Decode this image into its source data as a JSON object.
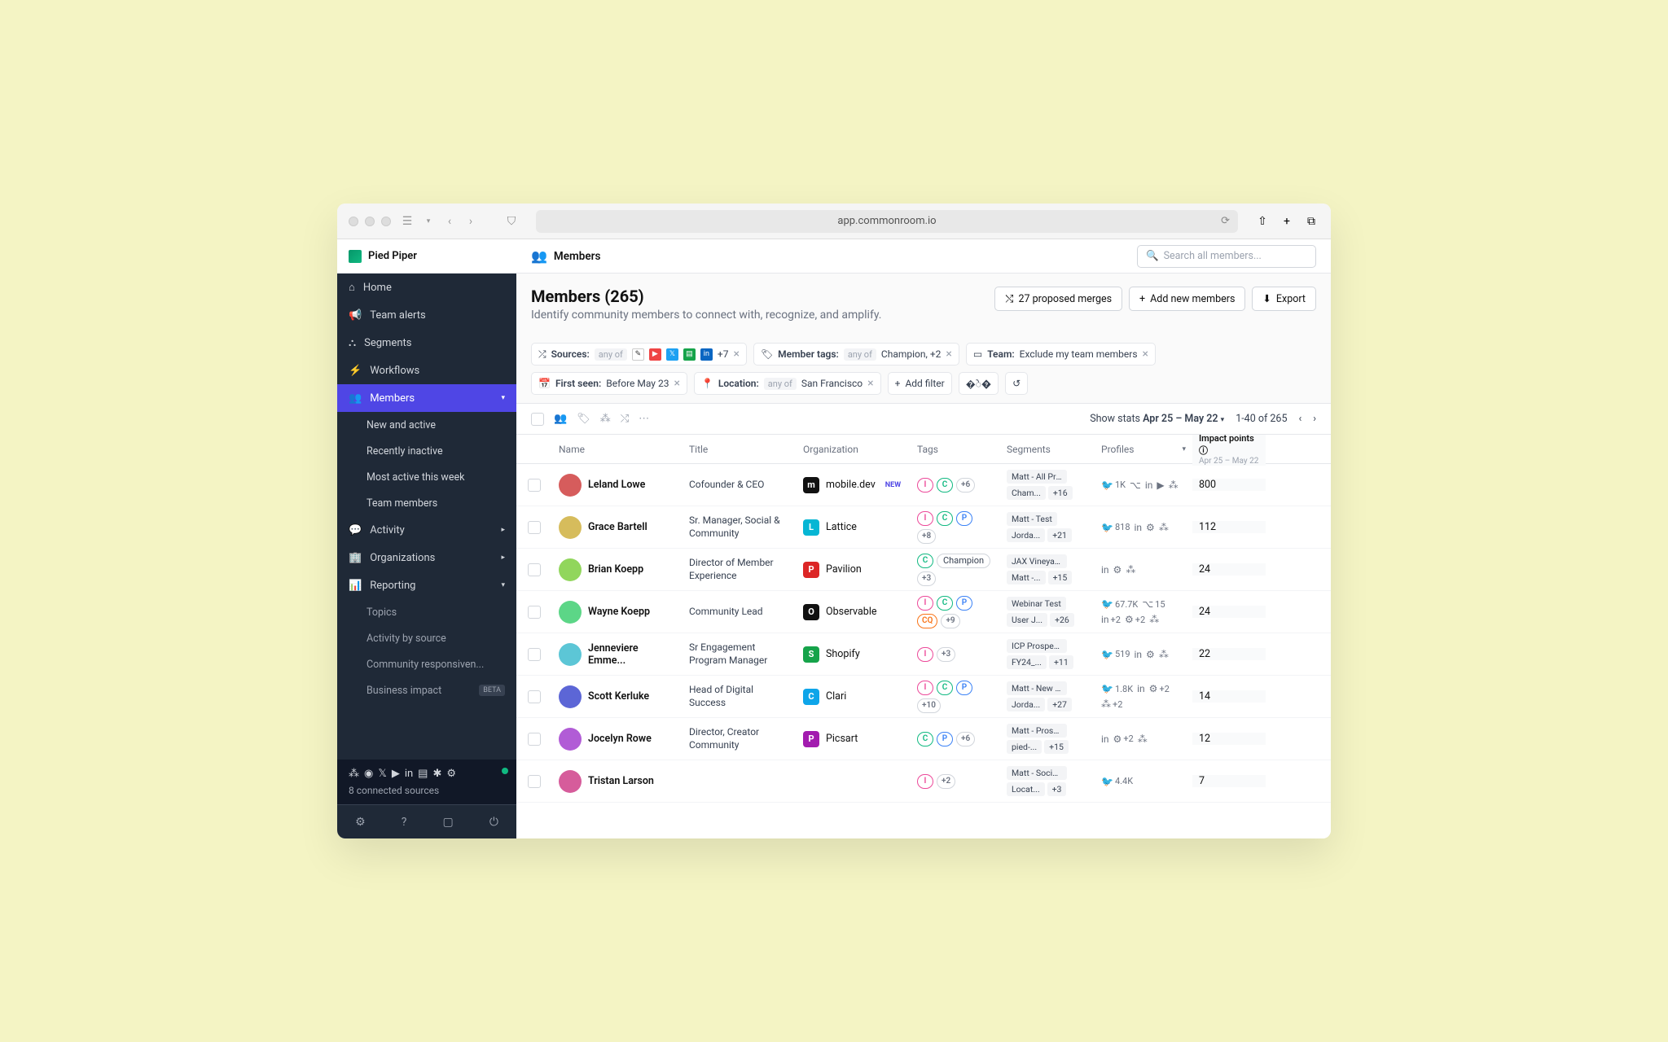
{
  "browser": {
    "url": "app.commonroom.io"
  },
  "workspace": {
    "name": "Pied Piper"
  },
  "sidebar": {
    "items": [
      "Home",
      "Team alerts",
      "Segments",
      "Workflows",
      "Members",
      "Activity",
      "Organizations",
      "Reporting"
    ],
    "members_sub": [
      "New and active",
      "Recently inactive",
      "Most active this week",
      "Team members"
    ],
    "reporting_sub": [
      "Topics",
      "Activity by source",
      "Community responsiven...",
      "Business impact"
    ],
    "beta": "BETA",
    "connected": "8 connected sources"
  },
  "topbar": {
    "title": "Members",
    "search_ph": "Search all members..."
  },
  "header": {
    "title": "Members (265)",
    "subtitle": "Identify community members to connect with, recognize, and amplify.",
    "merges": "27 proposed merges",
    "add": "Add new members",
    "export": "Export"
  },
  "filters": {
    "sources_label": "Sources:",
    "sources_mode": "any of",
    "sources_more": "+7",
    "tags_label": "Member tags:",
    "tags_mode": "any of",
    "tags_val": "Champion, +2",
    "team_label": "Team:",
    "team_val": "Exclude my team members",
    "first_label": "First seen:",
    "first_val": "Before May 23",
    "loc_label": "Location:",
    "loc_mode": "any of",
    "loc_val": "San Francisco",
    "add_filter": "Add filter"
  },
  "stats": {
    "label": "Show stats",
    "range": "Apr 25 – May 22",
    "pager": "1-40 of 265"
  },
  "cols": {
    "name": "Name",
    "title": "Title",
    "org": "Organization",
    "tags": "Tags",
    "seg": "Segments",
    "prof": "Profiles",
    "imp": "Impact points",
    "imp_sub": "Apr 25 – May 22"
  },
  "rows": [
    {
      "name": "Leland Lowe",
      "title": "Cofounder & CEO",
      "org": "mobile.dev",
      "org_new": true,
      "org_color": "#111",
      "tags": [
        "I",
        "C"
      ],
      "tags_more": "+6",
      "seg1": "Matt - All Produc...",
      "seg2": "Cham...",
      "seg_more": "+16",
      "prof": [
        [
          "tw",
          "1K"
        ],
        [
          "gh",
          ""
        ],
        [
          "li",
          ""
        ],
        [
          "yt",
          ""
        ],
        [
          "sl",
          ""
        ]
      ],
      "imp": "800"
    },
    {
      "name": "Grace Bartell",
      "title": "Sr. Manager, Social & Community",
      "org": "Lattice",
      "org_color": "#06b6d4",
      "tags": [
        "I",
        "C",
        "P"
      ],
      "tags_more": "+8",
      "seg1": "Matt - Test",
      "seg2": "Jorda...",
      "seg_more": "+21",
      "prof": [
        [
          "tw",
          "818"
        ],
        [
          "li",
          ""
        ],
        [
          "hb",
          ""
        ],
        [
          "sl",
          ""
        ]
      ],
      "imp": "112"
    },
    {
      "name": "Brian Koepp",
      "title": "Director of Member Experience",
      "org": "Pavilion",
      "org_color": "#dc2626",
      "tags": [
        "C"
      ],
      "tags_full": "Champion",
      "tags_more": "+3",
      "seg1": "JAX Vineyard Co...",
      "seg2": "Matt -...",
      "seg_more": "+15",
      "prof": [
        [
          "li",
          ""
        ],
        [
          "hb",
          ""
        ],
        [
          "sl",
          ""
        ]
      ],
      "imp": "24"
    },
    {
      "name": "Wayne Koepp",
      "title": "Community Lead",
      "org": "Observable",
      "org_color": "#111",
      "tags": [
        "I",
        "C",
        "P",
        "CQ"
      ],
      "tags_more": "+9",
      "seg1": "Webinar Test",
      "seg2": "User J...",
      "seg_more": "+26",
      "prof": [
        [
          "tw",
          "67.7K"
        ],
        [
          "gh",
          "15"
        ],
        [
          "li",
          "+2"
        ],
        [
          "hb",
          "+2"
        ],
        [
          "sl",
          ""
        ]
      ],
      "imp": "24"
    },
    {
      "name": "Jenneviere Emme...",
      "title": "Sr Engagement Program Manager",
      "org": "Shopify",
      "org_color": "#16a34a",
      "tags": [
        "I"
      ],
      "tags_more": "+3",
      "seg1": "ICP Prospecting ...",
      "seg2": "FY24_...",
      "seg_more": "+11",
      "prof": [
        [
          "tw",
          "519"
        ],
        [
          "li",
          ""
        ],
        [
          "hb",
          ""
        ],
        [
          "sl",
          ""
        ]
      ],
      "imp": "22"
    },
    {
      "name": "Scott Kerluke",
      "title": "Head of Digital Success",
      "org": "Clari",
      "org_color": "#0ea5e9",
      "tags": [
        "I",
        "C",
        "P"
      ],
      "tags_more": "+10",
      "seg1": "Matt - New Rooms",
      "seg2": "Jorda...",
      "seg_more": "+27",
      "prof": [
        [
          "tw",
          "1.8K"
        ],
        [
          "li",
          ""
        ],
        [
          "hb",
          "+2"
        ],
        [
          "sl",
          "+2"
        ]
      ],
      "imp": "14"
    },
    {
      "name": "Jocelyn Rowe",
      "title": "Director, Creator Community",
      "org": "Picsart",
      "org_color": "#a21caf",
      "tags": [
        "C",
        "P"
      ],
      "tags_more": "+6",
      "seg1": "Matt - Prospects...",
      "seg2": "pied-...",
      "seg_more": "+15",
      "prof": [
        [
          "li",
          ""
        ],
        [
          "hb",
          "+2"
        ],
        [
          "sl",
          ""
        ]
      ],
      "imp": "12"
    },
    {
      "name": "Tristan Larson",
      "title": "",
      "org": "",
      "tags": [
        "I"
      ],
      "tags_more": "+2",
      "seg1": "Matt - Social (No...",
      "seg2": "Locat...",
      "seg_more": "+3",
      "prof": [
        [
          "tw",
          "4.4K"
        ]
      ],
      "imp": "7"
    }
  ]
}
